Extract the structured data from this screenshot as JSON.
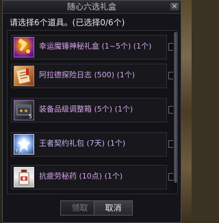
{
  "dialog": {
    "title": "随心六选礼盒",
    "close_glyph": "×",
    "prompt": "请选择6个道具。(已选择0/6个)"
  },
  "items": [
    {
      "label": "幸运魔锤神秘礼盒 (1~5个) (1个)",
      "icon": "lucky-hammer-box-icon",
      "checked": false
    },
    {
      "label": "阿拉德探险日志 (500) (1个)",
      "icon": "adventure-log-icon",
      "checked": false
    },
    {
      "label": "装备品级调整箱 (5个) (1个)",
      "icon": "grade-adjust-box-icon",
      "icon_badge": "5",
      "checked": false
    },
    {
      "label": "王者契约礼包 (7天) (1个)",
      "icon": "king-contract-pack-icon",
      "icon_badge": "7天",
      "checked": false
    },
    {
      "label": "抗疲劳秘药 (10点) (1个)",
      "icon": "anti-fatigue-potion-icon",
      "checked": false
    }
  ],
  "buttons": {
    "claim": "领取",
    "cancel": "取消"
  }
}
